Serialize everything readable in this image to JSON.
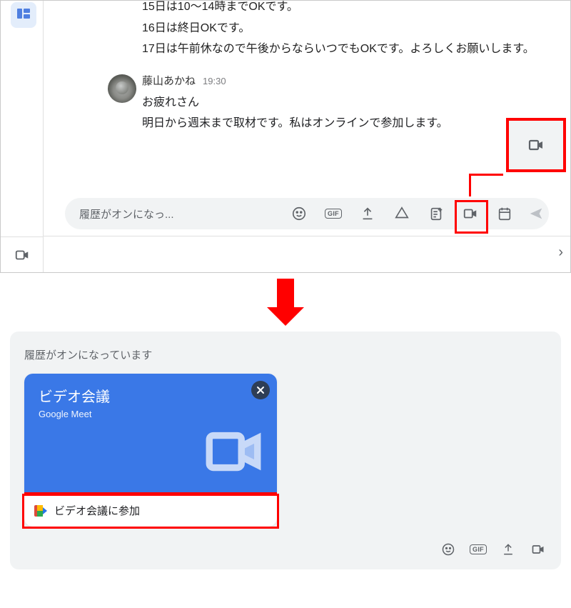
{
  "chat": {
    "prev_message_lines": [
      "15日は10～14時までOKです。",
      "16日は終日OKです。",
      "17日は午前休なので午後からならいつでもOKです。よろしくお願いします。"
    ],
    "msg2": {
      "author": "藤山あかね",
      "timestamp": "19:30",
      "lines": [
        "お疲れさん",
        "明日から週末まで取材です。私はオンラインで参加します。"
      ]
    }
  },
  "compose": {
    "placeholder_truncated": "履歴がオンになっ...",
    "icons": {
      "emoji": "emoji-icon",
      "gif": "GIF",
      "upload": "upload-icon",
      "drive": "drive-icon",
      "doc_plus": "doc-plus-icon",
      "video": "video-icon",
      "calendar": "calendar-icon",
      "send": "send-icon"
    }
  },
  "expand_chevron": "›",
  "history_banner": "履歴がオンになっています",
  "meet_card": {
    "title": "ビデオ会議",
    "subtitle": "Google Meet",
    "join_label": "ビデオ会議に参加"
  },
  "bottom_icons": {
    "emoji": "emoji-icon",
    "gif": "gif-icon",
    "upload": "upload-icon",
    "video": "video-icon"
  }
}
